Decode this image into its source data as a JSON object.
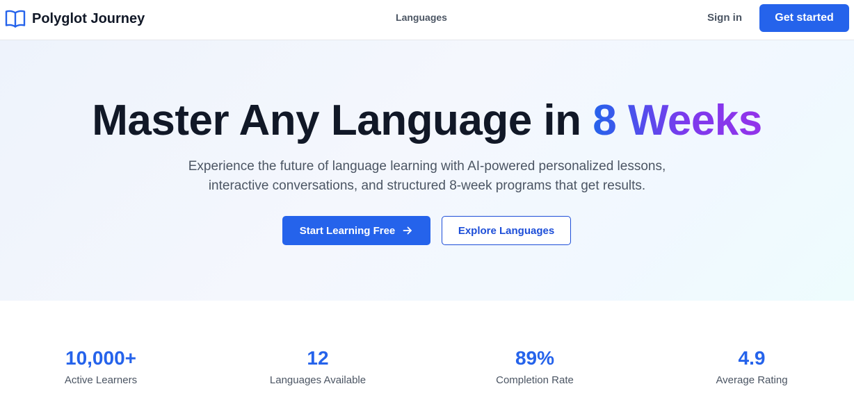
{
  "header": {
    "brand_name": "Polyglot Journey",
    "brand_icon": "open-book-icon",
    "nav": {
      "languages": "Languages"
    },
    "sign_in": "Sign in",
    "get_started": "Get started"
  },
  "hero": {
    "title_main": "Master Any Language in ",
    "title_highlight": "8 Weeks",
    "subtitle_line1": "Experience the future of language learning with AI-powered personalized lessons,",
    "subtitle_line2": "interactive conversations, and structured 8-week programs that get results.",
    "primary_cta": "Start Learning Free",
    "primary_cta_icon": "arrow-right-icon",
    "secondary_cta": "Explore Languages"
  },
  "stats": [
    {
      "value": "10,000+",
      "label": "Active Learners"
    },
    {
      "value": "12",
      "label": "Languages Available"
    },
    {
      "value": "89%",
      "label": "Completion Rate"
    },
    {
      "value": "4.9",
      "label": "Average Rating"
    }
  ],
  "colors": {
    "accent": "#2563eb",
    "gradient_start": "#2563eb",
    "gradient_end": "#9333ea",
    "text_dark": "#111827",
    "text_muted": "#4b5563"
  }
}
